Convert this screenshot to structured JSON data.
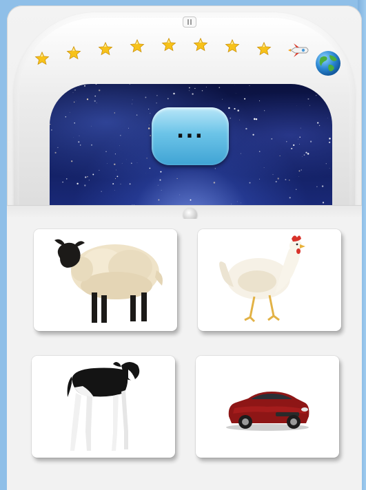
{
  "hud": {
    "pause_icon": "pause-icon",
    "stars_earned": 8,
    "stars_total": 8,
    "star_color": "#f7c21a",
    "rocket_icon": "rocket-icon",
    "globe_icon": "earth-globe-icon"
  },
  "prompt": {
    "bubble_text": "...",
    "bubble_color": "#6cc4e8"
  },
  "choices": [
    {
      "id": "sheep",
      "label": "sheep-picture"
    },
    {
      "id": "hen",
      "label": "hen-picture"
    },
    {
      "id": "calf",
      "label": "calf-picture"
    },
    {
      "id": "car",
      "label": "car-picture"
    }
  ]
}
